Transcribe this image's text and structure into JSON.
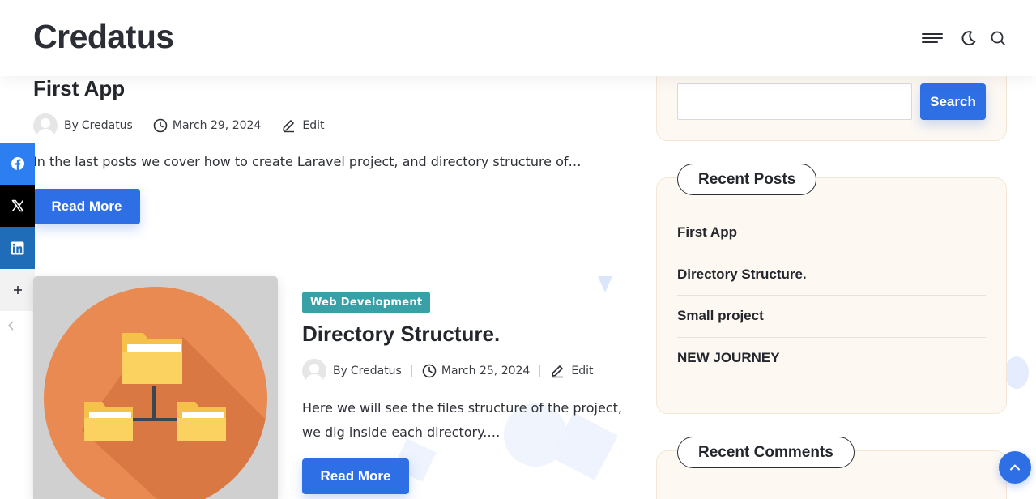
{
  "site": {
    "logo": "Credatus"
  },
  "header": {
    "icons": [
      "menu-icon",
      "moon-icon",
      "search-icon"
    ]
  },
  "share": {
    "items": [
      "facebook-icon",
      "x-icon",
      "linkedin-icon",
      "plus-icon"
    ],
    "collapse_icon": "chevron-left-icon"
  },
  "posts": [
    {
      "title": "First App",
      "author_prefix": "By",
      "author": "Credatus",
      "date": "March 29, 2024",
      "edit_label": "Edit",
      "excerpt": "In the last posts we cover how to create Laravel project, and directory structure of…",
      "read_more": "Read More"
    },
    {
      "category": "Web Development",
      "title": "Directory Structure.",
      "author_prefix": "By",
      "author": "Credatus",
      "date": "March 25, 2024",
      "edit_label": "Edit",
      "excerpt": "Here we will see the files structure of the project, we dig inside each directory.…",
      "read_more": "Read More",
      "thumbnail_icon": "folder-tree-icon"
    }
  ],
  "sidebar": {
    "search": {
      "button": "Search",
      "placeholder": ""
    },
    "recent_posts": {
      "heading": "Recent Posts",
      "items": [
        "First App",
        "Directory Structure.",
        "Small project",
        "NEW JOURNEY"
      ]
    },
    "recent_comments": {
      "heading": "Recent Comments"
    }
  },
  "colors": {
    "accent": "#2f6fe6",
    "badge": "#3aa0a8",
    "widget_bg": "#fdf8f2",
    "thumb_orange": "#e98a52"
  }
}
